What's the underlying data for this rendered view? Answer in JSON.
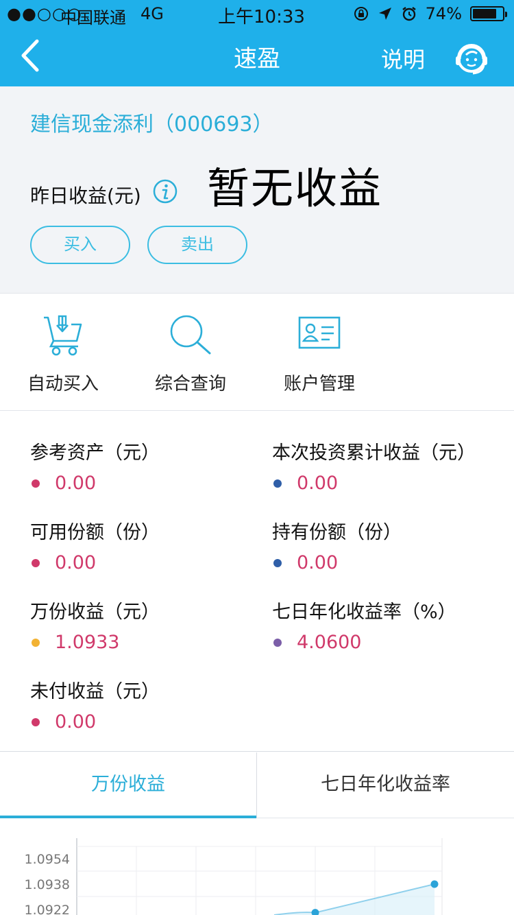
{
  "status_bar": {
    "signal": "●●○○○",
    "carrier": "中国联通",
    "network": "4G",
    "time": "上午10:33",
    "battery": "74%"
  },
  "header": {
    "title": "速盈",
    "explain": "说明",
    "back_icon": "chevron-left-icon",
    "service_icon": "customer-service-icon"
  },
  "summary": {
    "fund_name": "建信现金添利（000693）",
    "yield_label": "昨日收益(元)",
    "yield_value": "暂无收益",
    "buy_label": "买入",
    "sell_label": "卖出"
  },
  "shortcuts": [
    {
      "label": "自动买入",
      "icon": "cart-download-icon"
    },
    {
      "label": "综合查询",
      "icon": "search-icon"
    },
    {
      "label": "账户管理",
      "icon": "id-card-icon"
    }
  ],
  "stats": [
    {
      "label": "参考资产（元）",
      "value": "0.00",
      "dot_color": "#d0396a"
    },
    {
      "label": "本次投资累计收益（元）",
      "value": "0.00",
      "dot_color": "#2f5fa8"
    },
    {
      "label": "可用份额（份）",
      "value": "0.00",
      "dot_color": "#d0396a"
    },
    {
      "label": "持有份额（份）",
      "value": "0.00",
      "dot_color": "#2f5fa8"
    },
    {
      "label": "万份收益（元）",
      "value": "1.0933",
      "dot_color": "#f2b233"
    },
    {
      "label": "七日年化收益率（%）",
      "value": "4.0600",
      "dot_color": "#7b5ea8"
    },
    {
      "label": "未付收益（元）",
      "value": "0.00",
      "dot_color": "#d0396a"
    }
  ],
  "tabs": [
    {
      "label": "万份收益",
      "active": true
    },
    {
      "label": "七日年化收益率",
      "active": false
    }
  ],
  "colors": {
    "brand": "#1fb0ea",
    "accent": "#2baed8",
    "value": "#d0396a"
  },
  "chart_data": {
    "type": "line",
    "y_ticks": [
      "1.0954",
      "1.0938",
      "1.0922"
    ],
    "points": [
      {
        "x": 4,
        "y": 1.092
      },
      {
        "x": 6,
        "y": 1.0938
      }
    ]
  }
}
